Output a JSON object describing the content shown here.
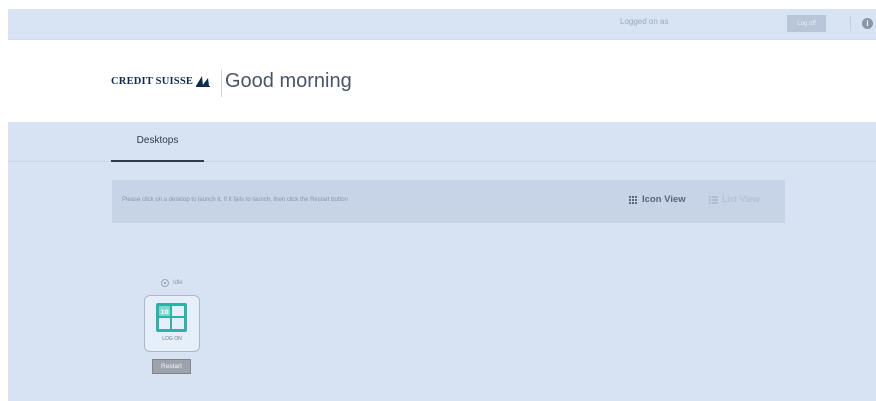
{
  "topbar": {
    "logged_on_label": "Logged on as",
    "logoff_label": "Log off",
    "info_icon": "info-icon"
  },
  "header": {
    "brand": "CREDIT SUISSE",
    "greeting": "Good morning"
  },
  "tabs": [
    {
      "label": "Desktops",
      "active": true
    }
  ],
  "banner": {
    "instruction": "Please click on a desktop to launch it. If it fails to launch, then click the Restart button",
    "icon_view_label": "Icon View",
    "list_view_label": "List View"
  },
  "desktops": [
    {
      "status": "Idle",
      "os_icon": "windows-10-icon",
      "action_label": "LOG ON",
      "restart_label": "Restart"
    }
  ],
  "colors": {
    "background": "#d7e2f2",
    "header": "#ffffff",
    "windows_tile": "#2bb3a8",
    "text_dark": "#2e3a4c"
  }
}
